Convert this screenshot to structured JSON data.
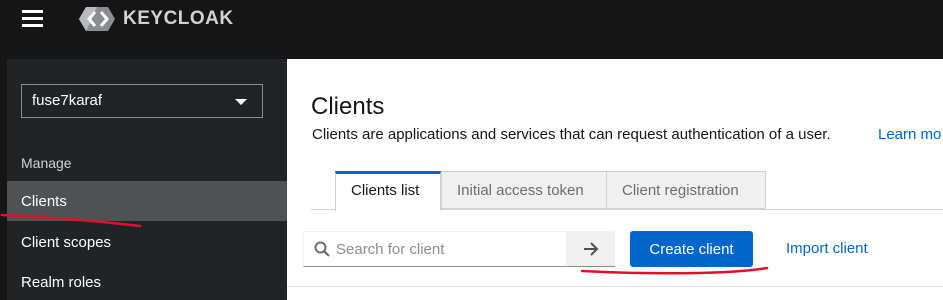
{
  "masthead": {
    "logo_text": "KEYCLOAK",
    "hamburger_icon": "menu-icon"
  },
  "sidebar": {
    "realm": "fuse7karaf",
    "group_title": "Manage",
    "items": [
      {
        "label": "Clients",
        "active": true
      },
      {
        "label": "Client scopes",
        "active": false
      },
      {
        "label": "Realm roles",
        "active": false
      }
    ]
  },
  "main": {
    "title": "Clients",
    "description": "Clients are applications and services that can request authentication of a user.",
    "learn_more": "Learn mo",
    "tabs": [
      {
        "label": "Clients list",
        "active": true
      },
      {
        "label": "Initial access token",
        "active": false
      },
      {
        "label": "Client registration",
        "active": false
      }
    ],
    "search": {
      "placeholder": "Search for client",
      "value": ""
    },
    "create_label": "Create client",
    "import_label": "Import client"
  },
  "colors": {
    "masthead": "#151515",
    "sidebar": "#212427",
    "active_nav": "#4f5255",
    "primary": "#0066cc",
    "annotation": "#e0102a"
  }
}
